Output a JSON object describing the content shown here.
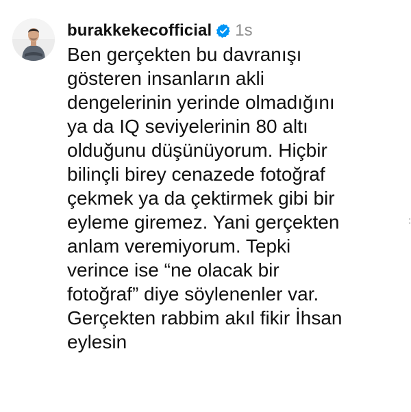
{
  "comment": {
    "username": "burakkekecofficial",
    "verified_icon": "verified-badge-icon",
    "timestamp": "1s",
    "lines": [
      "Ben gerçekten bu davranışı",
      "gösteren insanların akli",
      "dengelerinin yerinde olmadığını",
      "ya da IQ seviyelerinin 80 altı",
      "olduğunu düşünüyorum. Hiçbir",
      "bilinçli birey cenazede fotoğraf",
      "çekmek ya da çektirmek gibi bir",
      "eyleme giremez. Yani gerçekten",
      "anlam veremiyorum. Tepki",
      "verince ise “ne olacak bir",
      "fotoğraf” diye söylenenler var.",
      "Gerçekten rabbim akıl fikir İhsan",
      "eylesin"
    ]
  },
  "colors": {
    "text": "#111111",
    "muted": "#8e8e8e",
    "verified": "#0095f6",
    "background": "#ffffff"
  }
}
